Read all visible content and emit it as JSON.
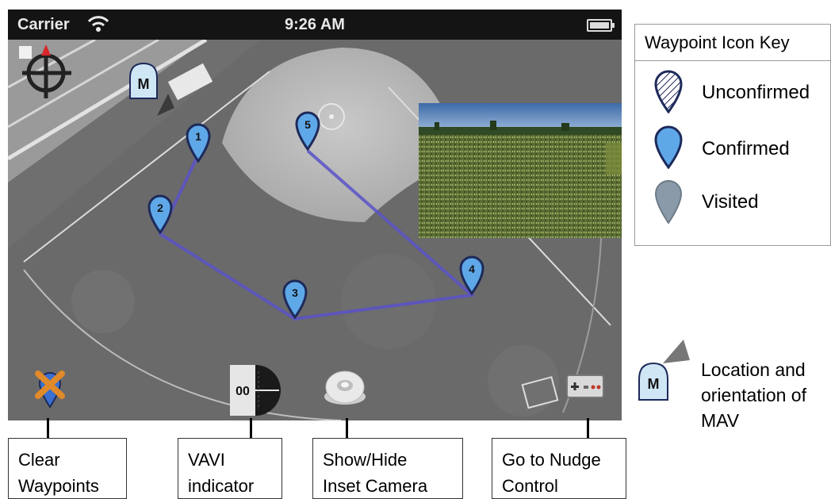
{
  "status_bar": {
    "carrier": "Carrier",
    "time": "9:26 AM"
  },
  "map": {
    "background": "grayscale aerial imagery of baseball field",
    "path_color": "#5b52c8",
    "waypoints": [
      {
        "label": "1",
        "state": "confirmed"
      },
      {
        "label": "2",
        "state": "confirmed"
      },
      {
        "label": "3",
        "state": "confirmed"
      },
      {
        "label": "4",
        "state": "confirmed"
      },
      {
        "label": "5",
        "state": "confirmed"
      }
    ],
    "mav_marker_label": "M"
  },
  "toolbar": {
    "clear_icon": "clear-waypoints-icon",
    "vavi_label": "00",
    "camera_icon": "camera-toggle-icon",
    "nudge_icon": "nudge-control-icon"
  },
  "callouts": {
    "clear": [
      "Clear",
      "Waypoints"
    ],
    "vavi": [
      "VAVI",
      "indicator"
    ],
    "camera": [
      "Show/Hide",
      "Inset Camera"
    ],
    "nudge": [
      "Go to Nudge",
      "Control"
    ]
  },
  "legend": {
    "title": "Waypoint Icon Key",
    "entries": [
      {
        "label": "Unconfirmed",
        "icon": "unconfirmed-waypoint-icon"
      },
      {
        "label": "Confirmed",
        "icon": "confirmed-waypoint-icon"
      },
      {
        "label": "Visited",
        "icon": "visited-waypoint-icon"
      }
    ],
    "mav_text": [
      "Location and",
      "orientation of",
      "MAV"
    ],
    "mav_label": "M"
  },
  "colors": {
    "waypoint_confirmed": "#5fa8e8",
    "waypoint_outline": "#1d2a5a",
    "waypoint_visited": "#8a9aa8",
    "mav_fill": "#cfe6f5",
    "path": "#5b52c8"
  }
}
